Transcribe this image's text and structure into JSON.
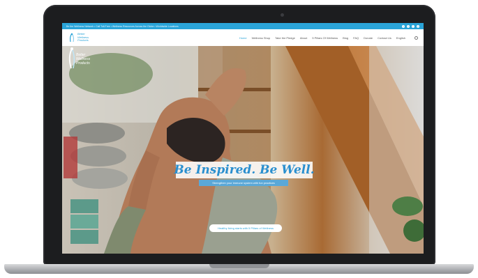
{
  "topbar": {
    "text": "Be the Wellness Network  •  Call Toll-Free  •  Wellness Resources Across the Globe  •  Worldwide Locations",
    "social": [
      "f",
      "t",
      "i",
      "y"
    ]
  },
  "header": {
    "logo_line1": "Better",
    "logo_line2": "Wellness",
    "logo_line3": "Products",
    "nav": [
      "Home",
      "Wellness Shop",
      "Take the Pledge",
      "About",
      "5 Pillars Of Wellness",
      "Blog",
      "FAQ",
      "Donate",
      "Contact Us",
      "English"
    ]
  },
  "hero": {
    "headline": "Be Inspired. Be Well.",
    "subline": "Strengthen your immune system with fun practices",
    "cta": "Healthy living starts with 5 Pillars of Wellness"
  },
  "colors": {
    "brand_blue": "#2aa4d8",
    "headline_blue": "#2a8fcf"
  }
}
